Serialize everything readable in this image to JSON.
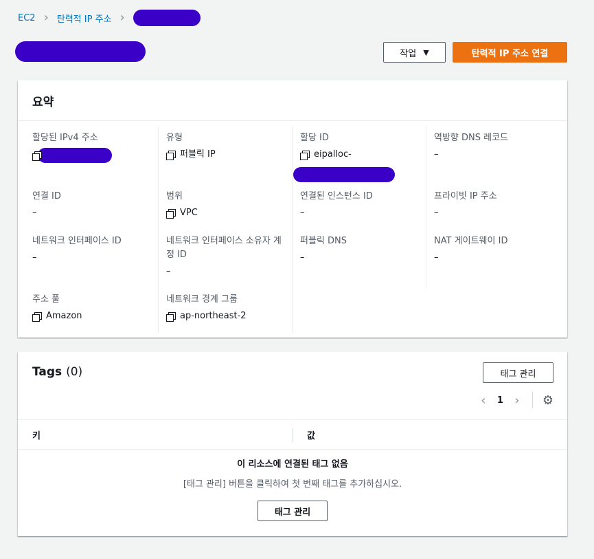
{
  "breadcrumb": {
    "root": "EC2",
    "section": "탄력적 IP 주소"
  },
  "header": {
    "actions_label": "작업",
    "associate_label": "탄력적 IP 주소 연결"
  },
  "summary": {
    "title": "요약",
    "fields": {
      "ipv4": {
        "label": "할당된 IPv4 주소"
      },
      "type": {
        "label": "유형",
        "value": "퍼블릭 IP"
      },
      "alloc": {
        "label": "할당 ID",
        "value": "eipalloc-"
      },
      "rdns": {
        "label": "역방향 DNS 레코드",
        "value": "–"
      },
      "assoc": {
        "label": "연결 ID",
        "value": "–"
      },
      "scope": {
        "label": "범위",
        "value": "VPC"
      },
      "instance": {
        "label": "연결된 인스턴스 ID",
        "value": "–"
      },
      "private_ip": {
        "label": "프라이빗 IP 주소",
        "value": "–"
      },
      "eni": {
        "label": "네트워크 인터페이스 ID",
        "value": "–"
      },
      "eni_owner": {
        "label": "네트워크 인터페이스 소유자 계정 ID",
        "value": "–"
      },
      "public_dns": {
        "label": "퍼블릭 DNS",
        "value": "–"
      },
      "nat": {
        "label": "NAT 게이트웨이 ID",
        "value": "–"
      },
      "pool": {
        "label": "주소 풀",
        "value": "Amazon"
      },
      "border": {
        "label": "네트워크 경계 그룹",
        "value": "ap-northeast-2"
      }
    }
  },
  "tags": {
    "title": "Tags",
    "count": "(0)",
    "manage_label": "태그 관리",
    "page": "1",
    "col_key": "키",
    "col_value": "값",
    "empty_title": "이 리소스에 연결된 태그 없음",
    "empty_sub": "[태그 관리] 버튼을 클릭하여 첫 번째 태그를 추가하십시오.",
    "empty_button": "태그 관리"
  }
}
